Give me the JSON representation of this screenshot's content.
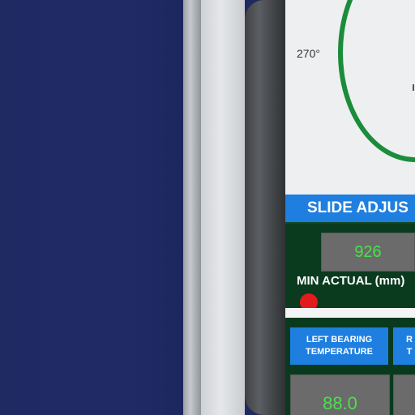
{
  "dial": {
    "angle_label": "270°"
  },
  "slide": {
    "section_title": "SLIDE ADJUS",
    "value": "926",
    "min_actual_label": "MIN ACTUAL (mm)",
    "indicator_color": "#e21b1b"
  },
  "temperature": {
    "left_label_line1": "LEFT BEARING",
    "left_label_line2": "TEMPERATURE",
    "right_label_line1": "R",
    "right_label_line2": "T",
    "left_value": "88.0"
  },
  "colors": {
    "accent_blue": "#1f7fe0",
    "panel_green": "#0b3b1f",
    "value_green": "#48e24a",
    "dial_green": "#1a8c3a",
    "background_navy": "#1f2a63"
  }
}
